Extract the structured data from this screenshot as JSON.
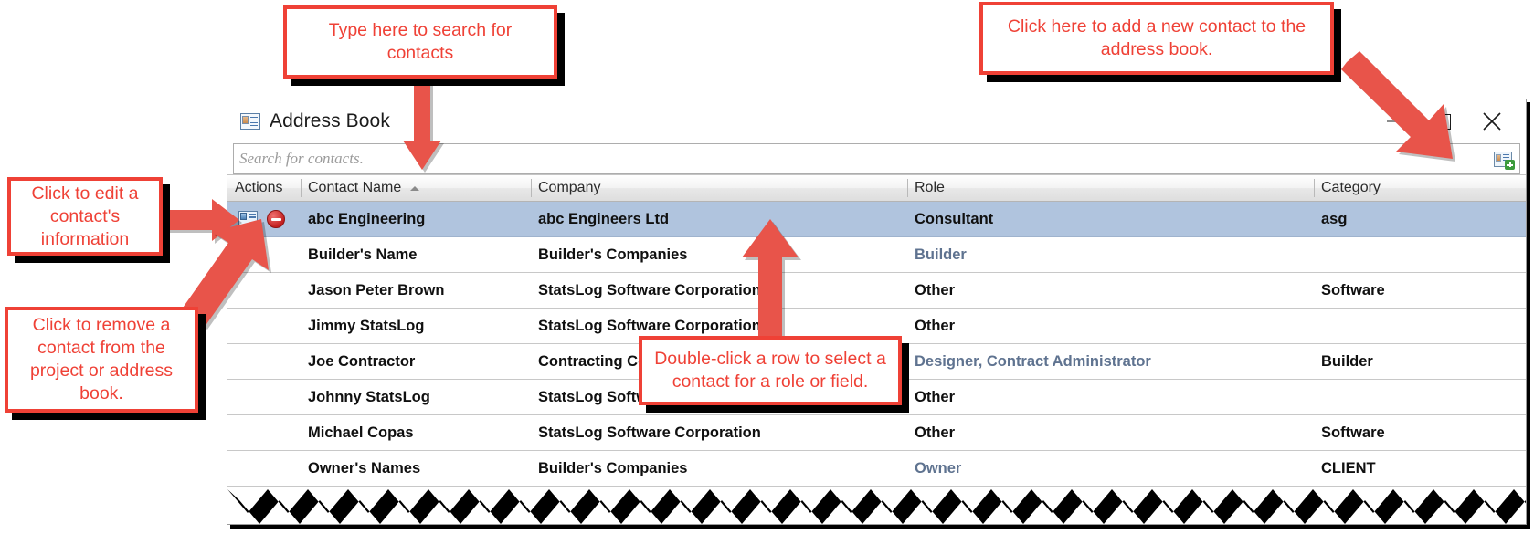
{
  "window": {
    "title": "Address Book",
    "title_icon": "address-card-icon",
    "controls": {
      "minimize": "minimize-icon",
      "maximize": "maximize-icon",
      "close": "close-icon"
    }
  },
  "search": {
    "placeholder": "Search for contacts.",
    "value": "",
    "add_button_icon": "add-contact-icon"
  },
  "table": {
    "columns": [
      {
        "label": "Actions",
        "sorted": false
      },
      {
        "label": "Contact Name",
        "sorted": true,
        "sort_dir": "asc"
      },
      {
        "label": "Company",
        "sorted": false
      },
      {
        "label": "Role",
        "sorted": false
      },
      {
        "label": "Category",
        "sorted": false
      }
    ],
    "rows": [
      {
        "selected": true,
        "has_actions": true,
        "edit_icon": "edit-contact-icon",
        "delete_icon": "remove-contact-icon",
        "name": "abc Engineering",
        "company": "abc Engineers Ltd",
        "role": "Consultant",
        "role_muted": false,
        "category": "asg"
      },
      {
        "selected": false,
        "has_actions": false,
        "name": "Builder's Name",
        "company": "Builder's Companies",
        "role": "Builder",
        "role_muted": true,
        "category": ""
      },
      {
        "selected": false,
        "has_actions": false,
        "name": "Jason Peter Brown",
        "company": "StatsLog Software Corporation",
        "role": "Other",
        "role_muted": false,
        "category": "Software"
      },
      {
        "selected": false,
        "has_actions": false,
        "name": "Jimmy StatsLog",
        "company": "StatsLog Software Corporation",
        "role": "Other",
        "role_muted": false,
        "category": ""
      },
      {
        "selected": false,
        "has_actions": false,
        "name": "Joe Contractor",
        "company": "Contracting Co.",
        "role": "Designer, Contract Administrator",
        "role_muted": true,
        "category": "Builder"
      },
      {
        "selected": false,
        "has_actions": false,
        "name": "Johnny StatsLog",
        "company": "StatsLog Software Corporation",
        "role": "Other",
        "role_muted": false,
        "category": ""
      },
      {
        "selected": false,
        "has_actions": false,
        "name": "Michael Copas",
        "company": "StatsLog Software Corporation",
        "role": "Other",
        "role_muted": false,
        "category": "Software"
      },
      {
        "selected": false,
        "has_actions": false,
        "name": "Owner's Names",
        "company": "Builder's Companies",
        "role": "Owner",
        "role_muted": true,
        "category": "CLIENT"
      }
    ]
  },
  "callouts": [
    {
      "id": "search-callout",
      "text": "Type here to search for contacts"
    },
    {
      "id": "add-contact-callout",
      "text": "Click here to add a new contact to the address book."
    },
    {
      "id": "edit-callout",
      "text": "Click to edit a contact's information"
    },
    {
      "id": "remove-callout",
      "text": "Click to remove a contact from the project or address book."
    },
    {
      "id": "double-click-callout",
      "text": "Double-click a row to select a contact for a role or field."
    }
  ],
  "colors": {
    "callout_red": "#ef4136",
    "selection_blue": "#b0c4de",
    "muted_role": "#5f7390"
  }
}
